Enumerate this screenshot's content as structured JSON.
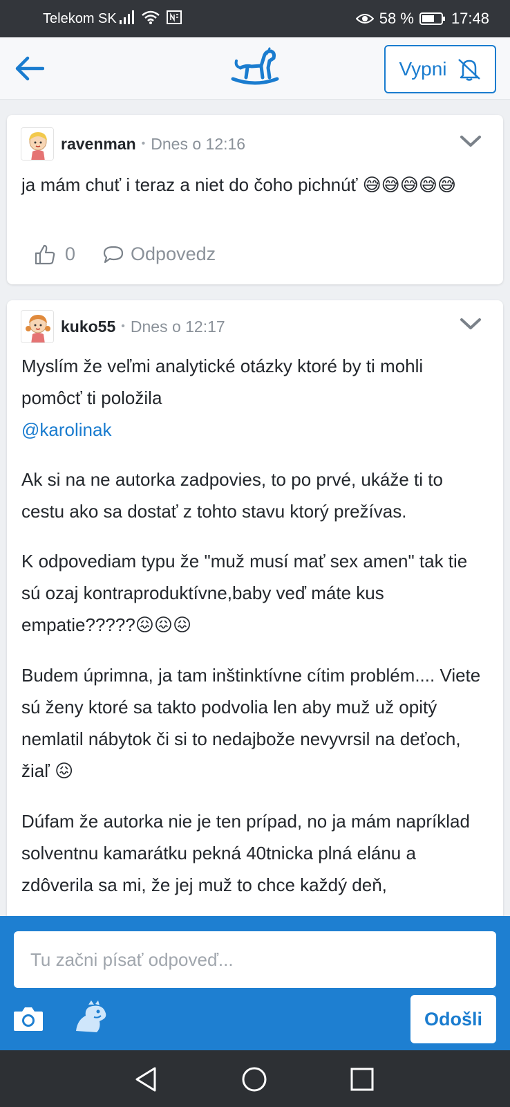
{
  "status": {
    "carrier": "Telekom SK",
    "battery": "58 %",
    "time": "17:48"
  },
  "header": {
    "mute_label": "Vypni"
  },
  "colors": {
    "accent": "#1a7ccf",
    "composer_bg": "#1e7fd1"
  },
  "posts": [
    {
      "author": "ravenman",
      "time": "Dnes o 12:16",
      "text": "ja mám chuť i teraz a niet do čoho pichnúť",
      "emojis": "😅😅😅😅😅",
      "likes": "0",
      "reply_label": "Odpovedz"
    },
    {
      "author": "kuko55",
      "time": "Dnes o 12:17",
      "p1": "Myslím že veľmi analytické otázky ktoré by ti mohli pomôcť ti položila",
      "mention": "@karolinak",
      "p2": "Ak si na ne autorka zadpovies, to po prvé, ukáže ti to cestu ako sa dostať z tohto stavu ktorý prežívas.",
      "p3": "K odpovediam typu že \"muž musí mať sex amen\" tak tie sú ozaj kontraproduktívne,baby veď máte kus empatie?????",
      "p3_emojis": "😖😖😖",
      "p4": "Budem úprimna, ja tam inštinktívne cítim problém.... Viete sú ženy ktoré sa takto podvolia len aby muž už opitý nemlatil nábytok či si to nedajbože nevyvrsil na deťoch, žiaľ",
      "p4_emojis": "😖",
      "p5": "Dúfam že autorka nie je ten prípad, no ja mám napríklad solventnu kamarátku pekná 40tnicka plná elánu a zdôverila sa mi, že jej muž to chce každý deň,"
    }
  ],
  "composer": {
    "placeholder": "Tu začni písať odpoveď...",
    "send_label": "Odošli"
  },
  "icons": {
    "back": "arrow-left-icon",
    "logo": "rocking-horse-icon",
    "mute": "bell-off-icon",
    "chevron": "chevron-down-icon",
    "like": "thumbs-up-icon",
    "reply": "speech-bubble-icon",
    "camera": "camera-icon",
    "mascot": "dino-mascot-icon"
  }
}
